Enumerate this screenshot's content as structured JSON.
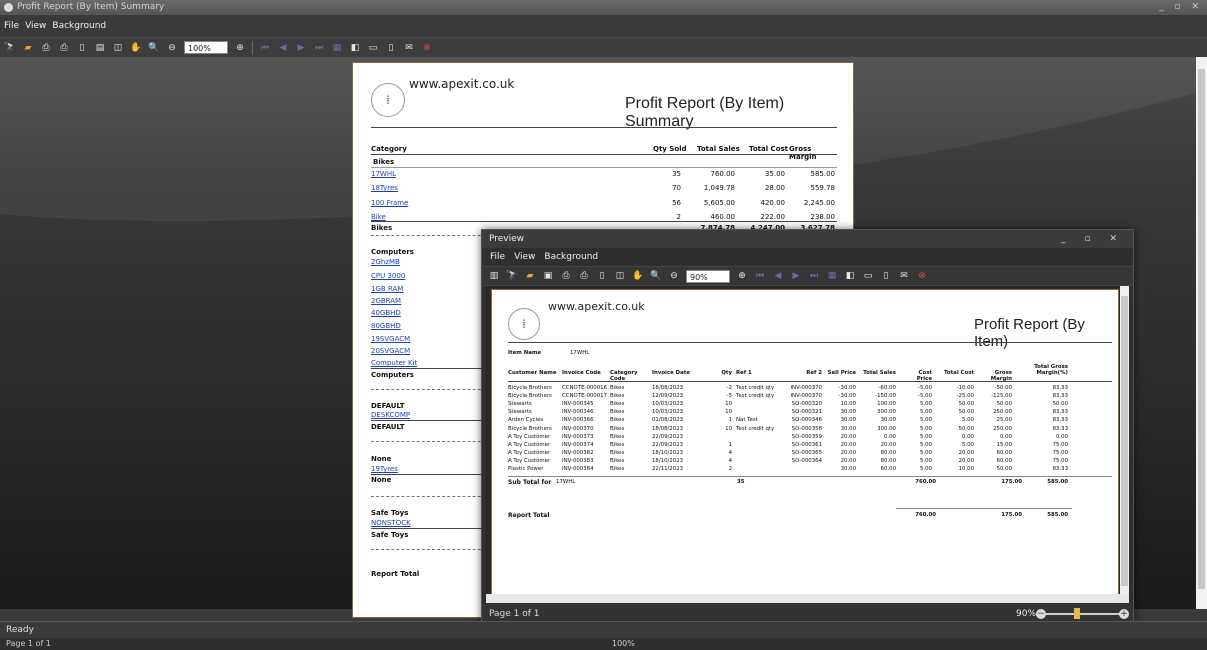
{
  "window": {
    "title": "Profit Report (By Item) Summary",
    "controls": "_ ▫ ✕"
  },
  "menu": [
    "File",
    "View",
    "Background"
  ],
  "toolbar": {
    "zoom": "100%"
  },
  "status": {
    "ready": "Ready",
    "page": "Page 1 of 1",
    "zoom": "100%"
  },
  "summary_report": {
    "url": "www.apexit.co.uk",
    "title": "Profit Report (By Item) Summary",
    "columns": [
      "Category",
      "Qty Sold",
      "Total Sales",
      "Total Cost",
      "Gross Margin"
    ],
    "groups": [
      {
        "name": "Bikes",
        "items": [
          {
            "item": "17WHL",
            "qty": "35",
            "sales": "760.00",
            "cost": "35.00",
            "margin": "585.00"
          },
          {
            "item": "18Tyres",
            "qty": "70",
            "sales": "1,049.78",
            "cost": "28.00",
            "margin": "559.78"
          },
          {
            "item": "100 Frame",
            "qty": "56",
            "sales": "5,605.00",
            "cost": "420.00",
            "margin": "2,245.00"
          },
          {
            "item": "Bike",
            "qty": "2",
            "sales": "460.00",
            "cost": "222.00",
            "margin": "238.00"
          }
        ],
        "total_label": "Bikes",
        "totals": {
          "sales": "7,874.78",
          "cost": "4,247.00",
          "margin": "3,627.78"
        }
      },
      {
        "name": "Computers",
        "items": [
          {
            "item": "2GhzMB"
          },
          {
            "item": "CPU 3000"
          },
          {
            "item": "1GB RAM"
          },
          {
            "item": "2GBRAM"
          },
          {
            "item": "40GBHD"
          },
          {
            "item": "80GBHD"
          },
          {
            "item": "19SVGACM"
          },
          {
            "item": "20SVGACM"
          },
          {
            "item": "Computer Kit"
          }
        ],
        "total_label": "Computers"
      },
      {
        "name": "DEFAULT",
        "items": [
          {
            "item": "DESKCOMP"
          }
        ],
        "total_label": "DEFAULT"
      },
      {
        "name": "None",
        "items": [
          {
            "item": "19Tyres"
          }
        ],
        "total_label": "None"
      },
      {
        "name": "Safe Toys",
        "items": [
          {
            "item": "NONSTOCK"
          }
        ],
        "total_label": "Safe Toys"
      }
    ],
    "report_total_label": "Report Total"
  },
  "preview": {
    "title": "Preview",
    "controls": "_ ▫ ✕",
    "menu": [
      "File",
      "View",
      "Background"
    ],
    "zoom": "90%",
    "page_status": "Page 1 of 1",
    "zoom_status": "90%",
    "report": {
      "url": "www.apexit.co.uk",
      "title": "Profit Report (By Item)",
      "item_name_label": "Item Name",
      "item_name_value": "17WHL",
      "columns": [
        "Customer Name",
        "Invoice Code",
        "Category Code",
        "Invoice Date",
        "Qty",
        "Ref 1",
        "Ref 2",
        "Sell Price",
        "Total Sales",
        "Cost Price",
        "Total Cost",
        "Gross Margin",
        "Total Gross Margin(%)"
      ],
      "rows": [
        [
          "Bicycle Brothers",
          "CCNOTE-000016",
          "Bikes",
          "18/08/2023",
          "-2",
          "Test credit qty",
          "INV-000370",
          "-30.00",
          "-60.00",
          "-5.00",
          "-10.00",
          "-50.00",
          "83.33"
        ],
        [
          "Bicycle Brothers",
          "CCNOTE-000017",
          "Bikes",
          "12/09/2023",
          "-5",
          "Test credit qty",
          "INV-000370",
          "-30.00",
          "-150.00",
          "-5.00",
          "-25.00",
          "-125.00",
          "83.33"
        ],
        [
          "Stewarts",
          "INV-000345",
          "Bikes",
          "10/03/2023",
          "10",
          "",
          "SO-000320",
          "10.00",
          "100.00",
          "5.00",
          "50.00",
          "50.00",
          "50.00"
        ],
        [
          "Stewarts",
          "INV-000346",
          "Bikes",
          "10/03/2023",
          "10",
          "",
          "SO-000321",
          "30.00",
          "300.00",
          "5.00",
          "50.00",
          "250.00",
          "83.33"
        ],
        [
          "Arden Cycles",
          "INV-000366",
          "Bikes",
          "01/08/2023",
          "1",
          "Nat Test",
          "SO-000346",
          "30.00",
          "30.00",
          "5.00",
          "5.00",
          "25.00",
          "83.33"
        ],
        [
          "Bicycle Brothers",
          "INV-000370",
          "Bikes",
          "18/08/2023",
          "10",
          "Test credit qty",
          "SO-000358",
          "30.00",
          "300.00",
          "5.00",
          "50.00",
          "250.00",
          "83.33"
        ],
        [
          "A Toy Customer",
          "INV-000373",
          "Bikes",
          "22/09/2023",
          "",
          "",
          "SO-000359",
          "20.00",
          "0.00",
          "5.00",
          "0.00",
          "0.00",
          "0.00"
        ],
        [
          "A Toy Customer",
          "INV-000374",
          "Bikes",
          "22/09/2023",
          "1",
          "",
          "SO-000361",
          "20.00",
          "20.00",
          "5.00",
          "5.00",
          "15.00",
          "75.00"
        ],
        [
          "A Toy Customer",
          "INV-000382",
          "Bikes",
          "18/10/2023",
          "4",
          "",
          "SO-000365",
          "20.00",
          "80.00",
          "5.00",
          "20.00",
          "60.00",
          "75.00"
        ],
        [
          "A Toy Customer",
          "INV-000383",
          "Bikes",
          "18/10/2023",
          "4",
          "",
          "SO-000364",
          "20.00",
          "80.00",
          "5.00",
          "20.00",
          "60.00",
          "75.00"
        ],
        [
          "Plastic Power",
          "INV-000384",
          "Bikes",
          "22/11/2023",
          "2",
          "",
          "",
          "30.00",
          "60.00",
          "5.00",
          "10.00",
          "50.00",
          "83.33"
        ]
      ],
      "subtotal_label": "Sub Total for",
      "subtotal_item": "17WHL",
      "subtotal": {
        "qty": "35",
        "sales": "760.00",
        "cost": "175.00",
        "margin": "585.00"
      },
      "report_total_label": "Report Total",
      "report_total": {
        "sales": "760.00",
        "cost": "175.00",
        "margin": "585.00"
      }
    }
  }
}
